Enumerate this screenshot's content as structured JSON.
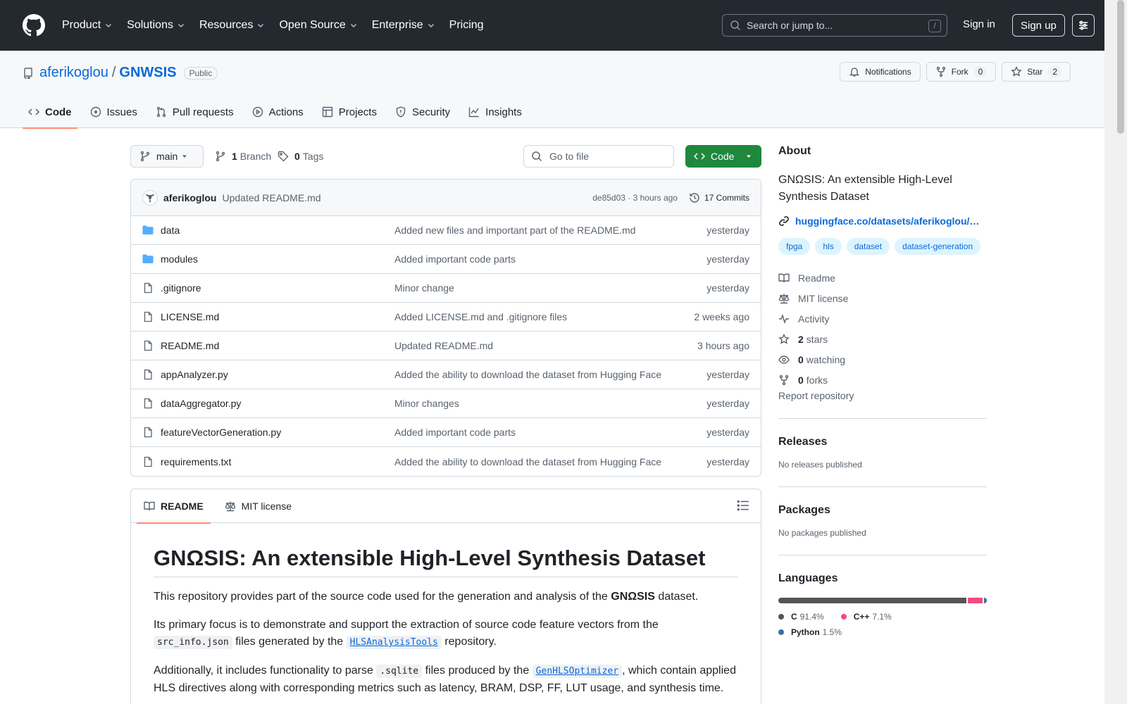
{
  "header": {
    "nav": [
      "Product",
      "Solutions",
      "Resources",
      "Open Source",
      "Enterprise",
      "Pricing"
    ],
    "search_placeholder": "Search or jump to...",
    "search_shortcut": "/",
    "sign_in": "Sign in",
    "sign_up": "Sign up"
  },
  "repo": {
    "owner": "aferikoglou",
    "separator": "/",
    "name": "GNWSIS",
    "visibility": "Public",
    "notifications_label": "Notifications",
    "fork_label": "Fork",
    "fork_count": "0",
    "star_label": "Star",
    "star_count": "2",
    "tabs": [
      "Code",
      "Issues",
      "Pull requests",
      "Actions",
      "Projects",
      "Security",
      "Insights"
    ]
  },
  "toolbar": {
    "branch": "main",
    "branch_count": "1",
    "branch_label": "Branch",
    "tag_count": "0",
    "tag_label": "Tags",
    "goto_placeholder": "Go to file",
    "code_label": "Code"
  },
  "commit": {
    "author": "aferikoglou",
    "message": "Updated README.md",
    "hash_time": "de85d03 · 3 hours ago",
    "commits": "17 Commits"
  },
  "files": [
    {
      "name": "data",
      "type": "dir",
      "message": "Added new files and important part of the README.md",
      "age": "yesterday"
    },
    {
      "name": "modules",
      "type": "dir",
      "message": "Added important code parts",
      "age": "yesterday"
    },
    {
      "name": ".gitignore",
      "type": "file",
      "message": "Minor change",
      "age": "yesterday"
    },
    {
      "name": "LICENSE.md",
      "type": "file",
      "message": "Added LICENSE.md and .gitignore files",
      "age": "2 weeks ago"
    },
    {
      "name": "README.md",
      "type": "file",
      "message": "Updated README.md",
      "age": "3 hours ago"
    },
    {
      "name": "appAnalyzer.py",
      "type": "file",
      "message": "Added the ability to download the dataset from Hugging Face",
      "age": "yesterday"
    },
    {
      "name": "dataAggregator.py",
      "type": "file",
      "message": "Minor changes",
      "age": "yesterday"
    },
    {
      "name": "featureVectorGeneration.py",
      "type": "file",
      "message": "Added important code parts",
      "age": "yesterday"
    },
    {
      "name": "requirements.txt",
      "type": "file",
      "message": "Added the ability to download the dataset from Hugging Face",
      "age": "yesterday"
    }
  ],
  "readme": {
    "tab_readme": "README",
    "tab_license": "MIT license",
    "title": "GNΩSIS: An extensible High-Level Synthesis Dataset",
    "p1_pre": "This repository provides part of the source code used for the generation and analysis of the ",
    "p1_bold": "GNΩSIS",
    "p1_post": " dataset.",
    "p2_pre": "Its primary focus is to demonstrate and support the extraction of source code feature vectors from the ",
    "p2_code": "src_info.json",
    "p2_mid": " files generated by the ",
    "p2_link": "HLSAnalysisTools",
    "p2_post": " repository.",
    "p3_pre": "Additionally, it includes functionality to parse ",
    "p3_code": ".sqlite",
    "p3_mid": " files produced by the ",
    "p3_link": "GenHLSOptimizer",
    "p3_post": ", which contain applied HLS directives along with corresponding metrics such as latency, BRAM, DSP, FF, LUT usage, and synthesis time."
  },
  "about": {
    "heading": "About",
    "description": "GNΩSIS: An extensible High-Level Synthesis Dataset",
    "link": "huggingface.co/datasets/aferikoglou/…",
    "topics": [
      "fpga",
      "hls",
      "dataset",
      "dataset-generation"
    ],
    "readme": "Readme",
    "license": "MIT license",
    "activity": "Activity",
    "stars_count": "2",
    "stars_label": "stars",
    "watching_count": "0",
    "watching_label": "watching",
    "forks_count": "0",
    "forks_label": "forks",
    "report": "Report repository"
  },
  "releases": {
    "heading": "Releases",
    "empty": "No releases published"
  },
  "packages": {
    "heading": "Packages",
    "empty": "No packages published"
  },
  "languages": {
    "heading": "Languages",
    "items": [
      {
        "name": "C",
        "percent": "91.4%",
        "value": 91.4,
        "color": "#555555"
      },
      {
        "name": "C++",
        "percent": "7.1%",
        "value": 7.1,
        "color": "#f34b7d"
      },
      {
        "name": "Python",
        "percent": "1.5%",
        "value": 1.5,
        "color": "#3572A5"
      }
    ]
  }
}
